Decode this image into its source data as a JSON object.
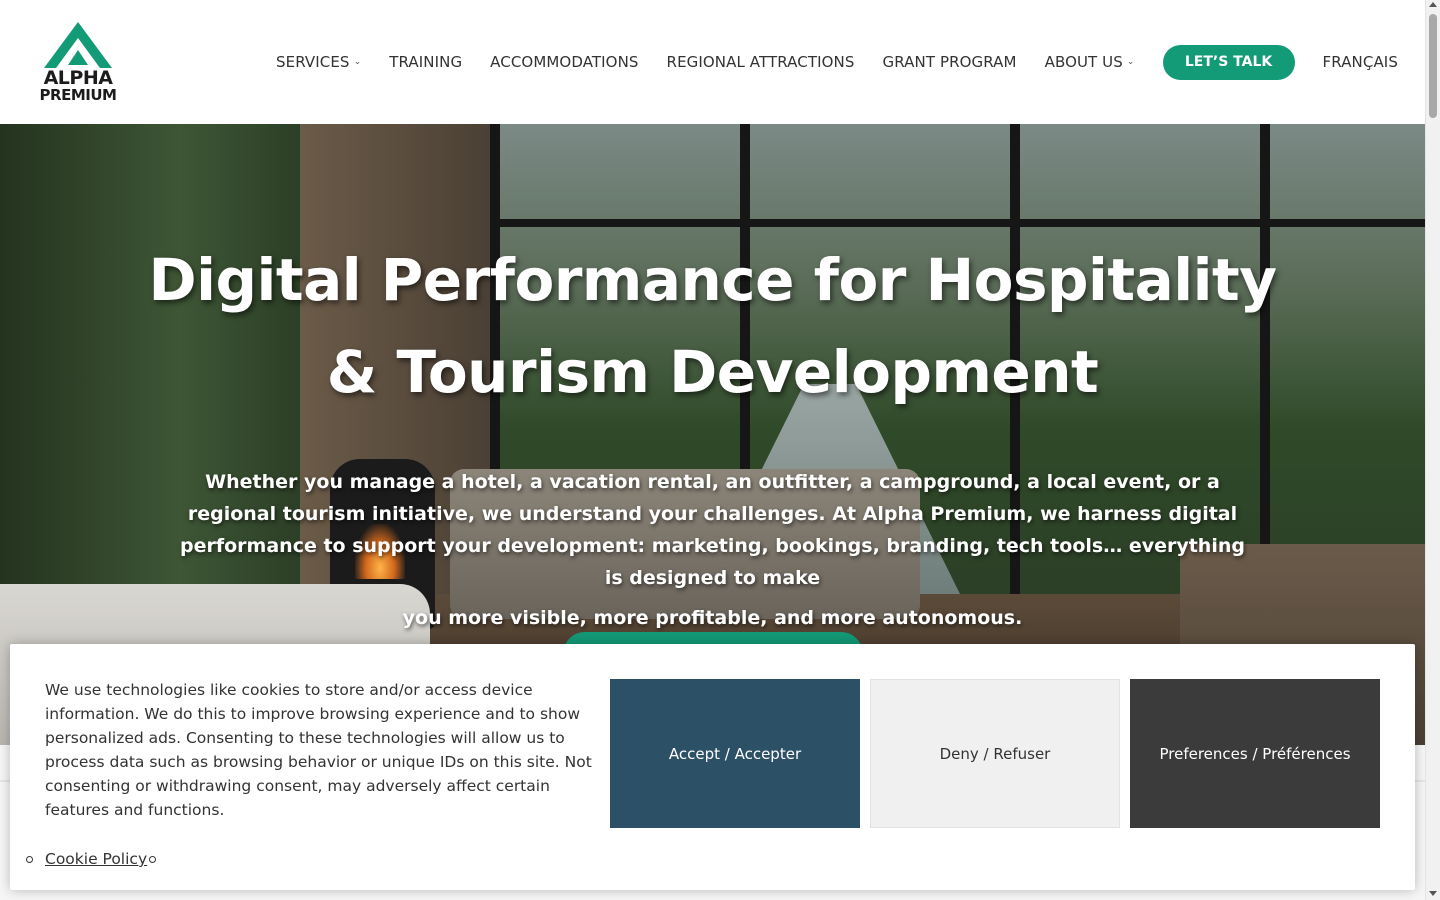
{
  "brand": {
    "name_line1": "ALPHA",
    "name_line2": "PREMIUM",
    "accent_color": "#139a76",
    "logo_icon": "mountain-triangle-icon"
  },
  "nav": {
    "items": [
      {
        "label": "SERVICES",
        "has_dropdown": true
      },
      {
        "label": "TRAINING",
        "has_dropdown": false
      },
      {
        "label": "ACCOMMODATIONS",
        "has_dropdown": false
      },
      {
        "label": "REGIONAL ATTRACTIONS",
        "has_dropdown": false
      },
      {
        "label": "GRANT PROGRAM",
        "has_dropdown": false
      },
      {
        "label": "ABOUT US",
        "has_dropdown": true
      }
    ],
    "chevron": "⌄",
    "cta_label": "LET’S TALK",
    "language_label": "FRANÇAIS"
  },
  "hero": {
    "title_line1": "Digital Performance for Hospitality",
    "title_line2": "& Tourism Development",
    "subtitle_main": "Whether you manage a hotel, a vacation rental, an outfitter, a campground, a local event, or a regional tourism initiative, we understand your challenges. At Alpha Premium, we harness digital performance to support your development: marketing, bookings, branding, tech tools… everything is designed to make",
    "subtitle_last": "you more visible, more profitable, and more autonomous."
  },
  "cookie_banner": {
    "message": "We use technologies like cookies to store and/or access device information. We do this to improve browsing experience and to show personalized ads. Consenting to these technologies will allow us to process data such as browsing behavior or unique IDs on this site. Not consenting or withdrawing consent, may adversely affect certain features and functions.",
    "accept_label": "Accept / Accepter",
    "deny_label": "Deny / Refuser",
    "preferences_label": "Preferences / Préférences",
    "cookie_policy_label": "Cookie Policy",
    "colors": {
      "accept_bg": "#2c5066",
      "deny_bg": "#f0f0f0",
      "preferences_bg": "#3b3b3b"
    }
  }
}
